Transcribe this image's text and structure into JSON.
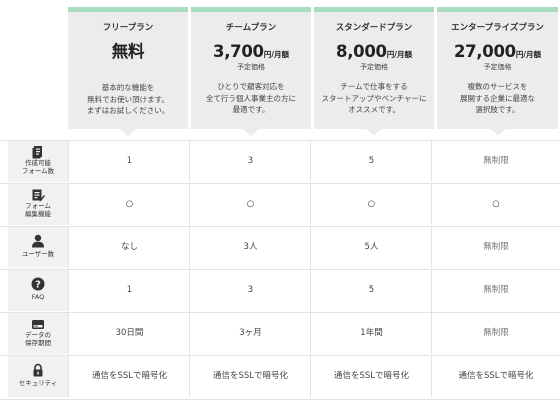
{
  "plans": [
    {
      "name": "フリープラン",
      "price": "無料",
      "unit": "",
      "price_label": "",
      "desc": [
        "基本的な機能を",
        "無料でお使い頂けます。",
        "まずはお試しください。"
      ]
    },
    {
      "name": "チームプラン",
      "price": "3,700",
      "unit": "円/月額",
      "price_label": "予定価格",
      "desc": [
        "ひとりで顧客対応を",
        "全て行う個人事業主の方に",
        "最適です。"
      ]
    },
    {
      "name": "スタンダードプラン",
      "price": "8,000",
      "unit": "円/月額",
      "price_label": "予定価格",
      "desc": [
        "チームで仕事をする",
        "スタートアップやベンチャーに",
        "オススメです。"
      ]
    },
    {
      "name": "エンタープライズプラン",
      "price": "27,000",
      "unit": "円/月額",
      "price_label": "予定価格",
      "desc": [
        "複数のサービスを",
        "展開する企業に最適な",
        "選択肢です。"
      ]
    }
  ],
  "features": [
    {
      "icon": "document-icon",
      "label": [
        "作成可能",
        "フォーム数"
      ],
      "values": [
        "1",
        "3",
        "5",
        "無制限"
      ]
    },
    {
      "icon": "form-edit-icon",
      "label": [
        "フォーム",
        "編集機能"
      ],
      "values": [
        "○",
        "○",
        "○",
        "○"
      ]
    },
    {
      "icon": "user-icon",
      "label": [
        "ユーザー数"
      ],
      "values": [
        "なし",
        "3人",
        "5人",
        "無制限"
      ]
    },
    {
      "icon": "help-icon",
      "label": [
        "FAQ"
      ],
      "values": [
        "1",
        "3",
        "5",
        "無制限"
      ]
    },
    {
      "icon": "storage-icon",
      "label": [
        "データの",
        "保存期間"
      ],
      "values": [
        "30日間",
        "3ヶ月",
        "1年間",
        "無制限"
      ]
    },
    {
      "icon": "lock-icon",
      "label": [
        "セキュリティ"
      ],
      "values": [
        "通信をSSLで暗号化",
        "通信をSSLで暗号化",
        "通信をSSLで暗号化",
        "通信をSSLで暗号化"
      ]
    }
  ]
}
